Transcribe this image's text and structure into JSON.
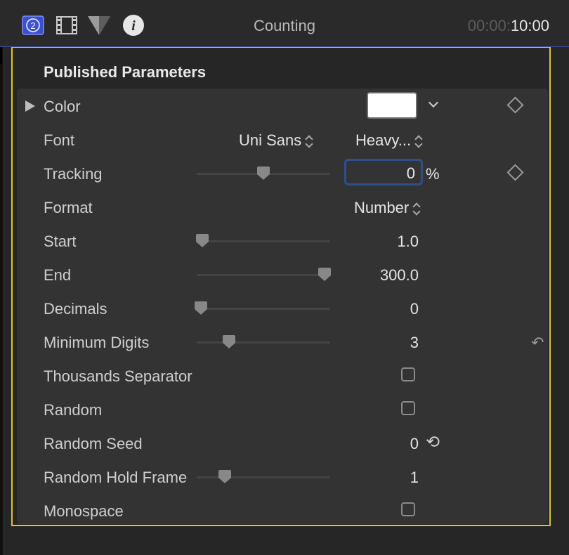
{
  "header": {
    "title": "Counting",
    "timecode_dim": "00:00:",
    "timecode_bright": "10:00"
  },
  "toolbar": {
    "icons": [
      "generator-inspector-icon",
      "video-inspector-icon",
      "audio-inspector-icon",
      "info-inspector-icon"
    ],
    "generator_badge": "2",
    "info_glyph": "i"
  },
  "inspector": {
    "section_title": "Published Parameters",
    "params": {
      "color": {
        "label": "Color",
        "swatch": "#ffffff"
      },
      "font": {
        "label": "Font",
        "family": "Uni Sans",
        "style": "Heavy..."
      },
      "tracking": {
        "label": "Tracking",
        "value": "0",
        "unit": "%",
        "slider": 0.5
      },
      "format": {
        "label": "Format",
        "value": "Number"
      },
      "start": {
        "label": "Start",
        "value": "1.0",
        "slider": 0.04
      },
      "end": {
        "label": "End",
        "value": "300.0",
        "slider": 0.96
      },
      "decimals": {
        "label": "Decimals",
        "value": "0",
        "slider": 0.03
      },
      "min_digits": {
        "label": "Minimum Digits",
        "value": "3",
        "slider": 0.24
      },
      "thousands": {
        "label": "Thousands Separator",
        "checked": false
      },
      "random": {
        "label": "Random",
        "checked": false
      },
      "random_seed": {
        "label": "Random Seed",
        "value": "0"
      },
      "random_hold": {
        "label": "Random Hold Frame",
        "value": "1",
        "slider": 0.21
      },
      "monospace": {
        "label": "Monospace",
        "checked": false
      }
    }
  },
  "colors": {
    "selection_border": "#e3c130",
    "accent": "#3e4fb6",
    "field_focus": "#2f4f8c"
  }
}
